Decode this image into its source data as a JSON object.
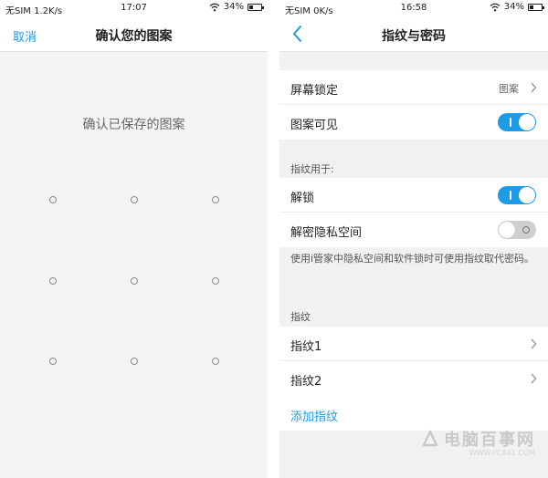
{
  "left": {
    "status": {
      "carrier": "无SIM 1.2K/s",
      "time": "17:07",
      "battery": "34%",
      "battery_level": 0.34
    },
    "nav": {
      "cancel_label": "取消",
      "title": "确认您的图案"
    },
    "prompt": "确认已保存的图案",
    "pattern_dots": 9
  },
  "right": {
    "status": {
      "carrier": "无SIM 0K/s",
      "time": "16:58",
      "battery": "34%",
      "battery_level": 0.34
    },
    "nav": {
      "title": "指纹与密码",
      "back_icon": "chevron-left-icon"
    },
    "lock_section": {
      "screen_lock": {
        "label": "屏幕锁定",
        "value": "图案"
      },
      "pattern_visible": {
        "label": "图案可见",
        "enabled": true
      }
    },
    "fingerprint_use": {
      "header": "指纹用于:",
      "unlock": {
        "label": "解锁",
        "enabled": true
      },
      "private_space": {
        "label": "解密隐私空间",
        "enabled": false
      },
      "note": "使用i管家中隐私空间和软件锁时可使用指纹取代密码。"
    },
    "fingerprints": {
      "header": "指纹",
      "items": [
        "指纹1",
        "指纹2"
      ],
      "add_label": "添加指纹"
    },
    "watermark": {
      "text": "电脑百事网",
      "url": "WWW.PC841.COM"
    }
  },
  "colors": {
    "accent": "#1e9be6",
    "toggle_off": "#cfcfcf",
    "background": "#f1f1f1"
  }
}
